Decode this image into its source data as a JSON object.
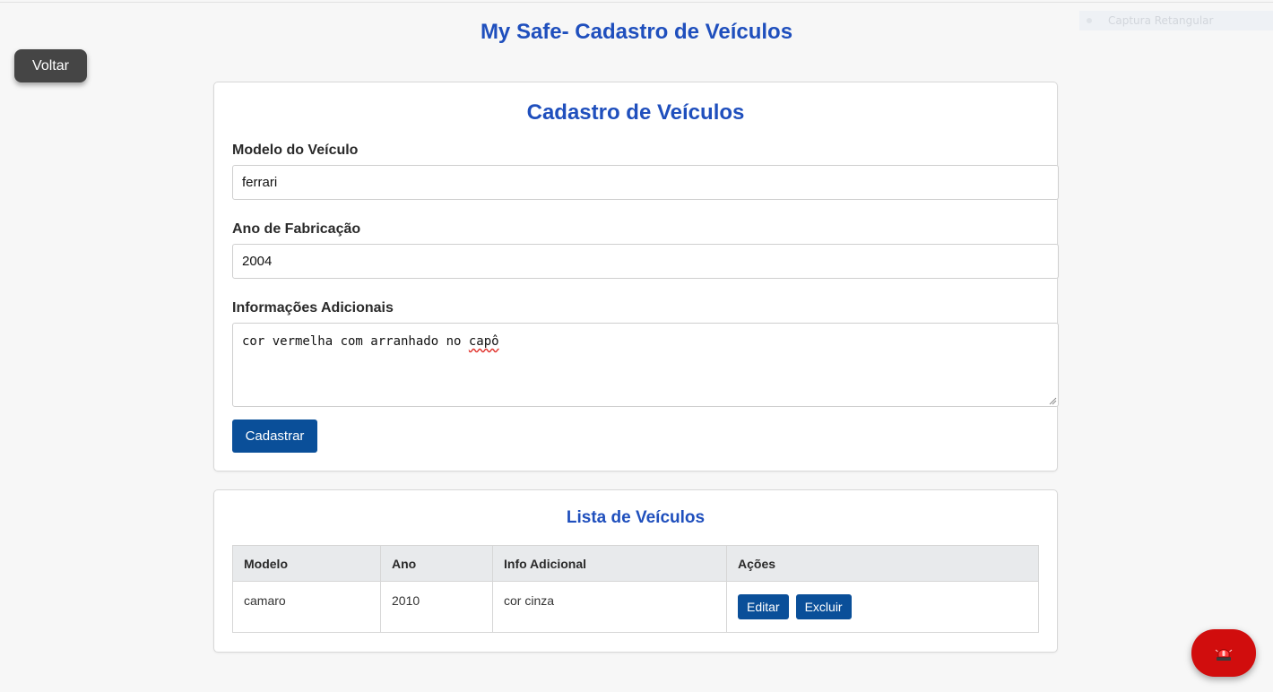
{
  "app_title": "My Safe- Cadastro de Veículos",
  "capture_widget": {
    "label": "Captura Retangular"
  },
  "back_button": "Voltar",
  "form": {
    "title": "Cadastro de Veículos",
    "model_label": "Modelo do Veículo",
    "model_value": "ferrari",
    "year_label": "Ano de Fabricação",
    "year_value": "2004",
    "info_label": "Informações Adicionais",
    "info_value_prefix": "cor vermelha com arranhado no ",
    "info_value_misspelled": "capô",
    "submit_label": "Cadastrar"
  },
  "list": {
    "title": "Lista de Veículos",
    "columns": [
      "Modelo",
      "Ano",
      "Info Adicional",
      "Ações"
    ],
    "rows": [
      {
        "modelo": "camaro",
        "ano": "2010",
        "info": "cor cinza",
        "edit_label": "Editar",
        "delete_label": "Excluir"
      }
    ]
  },
  "alarm_button": {
    "icon": "siren-icon"
  },
  "colors": {
    "title_blue": "#1f4fbd",
    "button_blue": "#0a4f99",
    "back_button": "#454545",
    "alarm_red": "#d10d0d",
    "page_bg": "#f7f7f7"
  }
}
